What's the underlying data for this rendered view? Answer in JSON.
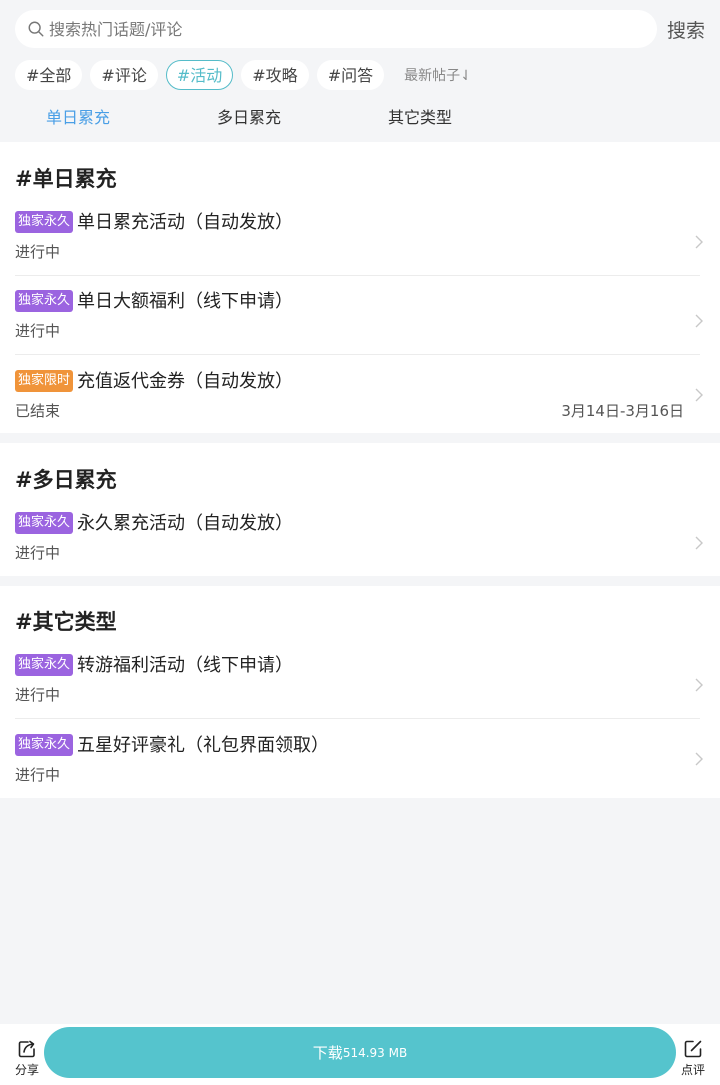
{
  "search": {
    "placeholder": "搜索热门话题/评论",
    "button_label": "搜索"
  },
  "tags": [
    "#全部",
    "#评论",
    "#活动",
    "#攻略",
    "#问答"
  ],
  "active_tag": "#活动",
  "sort_label": "最新帖子⇃",
  "tabs": [
    {
      "label": "单日累充",
      "active": true
    },
    {
      "label": "多日累充",
      "active": false
    },
    {
      "label": "其它类型",
      "active": false
    }
  ],
  "sections": [
    {
      "title": "#单日累充",
      "items": [
        {
          "badge": "独家永久",
          "title": "单日累充活动（自动发放）",
          "status": "进行中",
          "date": ""
        },
        {
          "badge": "独家永久",
          "title": "单日大额福利（线下申请）",
          "status": "进行中",
          "date": ""
        },
        {
          "badge": "独家限时",
          "title": "充值返代金券（自动发放）",
          "status": "已结束",
          "date": "3月14日-3月16日"
        }
      ]
    },
    {
      "title": "#多日累充",
      "items": [
        {
          "badge": "独家永久",
          "title": "永久累充活动（自动发放）",
          "status": "进行中",
          "date": ""
        }
      ]
    },
    {
      "title": "#其它类型",
      "items": [
        {
          "badge": "独家永久",
          "title": "转游福利活动（线下申请）",
          "status": "进行中",
          "date": ""
        },
        {
          "badge": "独家永久",
          "title": "五星好评豪礼（礼包界面领取）",
          "status": "进行中",
          "date": ""
        }
      ]
    }
  ],
  "bottom_bar": {
    "share_label": "分享",
    "download_label": "下载",
    "download_size": "514.93 MB",
    "review_label": "点评"
  },
  "colors": {
    "accent": "#55bcc9",
    "tab_active": "#4a9fe6",
    "badge_permanent": "#9b64e0",
    "badge_limited": "#f0943a",
    "download": "#55c4cd",
    "background": "#f4f5f7"
  }
}
